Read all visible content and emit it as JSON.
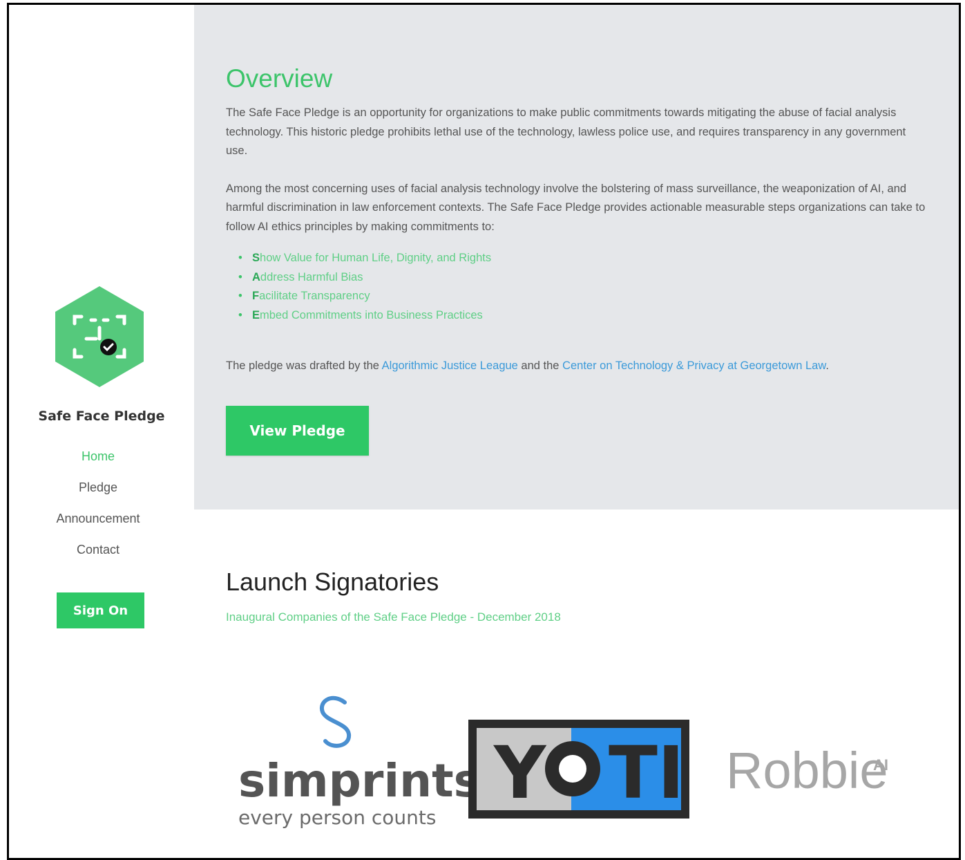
{
  "brand": {
    "name": "Safe Face Pledge",
    "logo_icon": "face-scan-hexagon-icon",
    "accent_color": "#2ec866"
  },
  "nav": {
    "items": [
      {
        "label": "Home",
        "active": true
      },
      {
        "label": "Pledge",
        "active": false
      },
      {
        "label": "Announcement",
        "active": false
      },
      {
        "label": "Contact",
        "active": false
      }
    ],
    "signon_label": "Sign On"
  },
  "overview": {
    "title": "Overview",
    "para1": "The Safe Face Pledge is an opportunity for organizations to make public commitments towards mitigating the abuse of facial analysis technology. This historic pledge prohibits lethal use of the technology, lawless police use, and requires transparency in any government use.",
    "para2": "Among the most concerning uses of facial analysis technology involve the bolstering of mass surveillance, the weaponization of AI, and harmful discrimination in law enforcement contexts. The Safe Face Pledge provides actionable measurable steps organizations can take to follow AI ethics principles by making commitments to:",
    "commitments": [
      {
        "first": "S",
        "rest": "how Value for Human Life, Dignity, and Rights"
      },
      {
        "first": "A",
        "rest": "ddress Harmful Bias"
      },
      {
        "first": "F",
        "rest": "acilitate Transparency"
      },
      {
        "first": "E",
        "rest": "mbed Commitments into Business Practices"
      }
    ],
    "drafted_prefix": "The pledge was drafted by the ",
    "drafted_link1": "Algorithmic Justice League",
    "drafted_mid": " and the ",
    "drafted_link2": "Center on Technology & Privacy at Georgetown Law",
    "drafted_suffix": ".",
    "view_pledge_label": "View Pledge"
  },
  "signatories": {
    "title": "Launch Signatories",
    "subtitle": "Inaugural Companies of the Safe Face Pledge - December 2018",
    "logos": [
      {
        "name": "simprints",
        "tagline": "every person counts"
      },
      {
        "name": "YOTI"
      },
      {
        "name": "Robbie",
        "suffix": "AI"
      }
    ]
  }
}
